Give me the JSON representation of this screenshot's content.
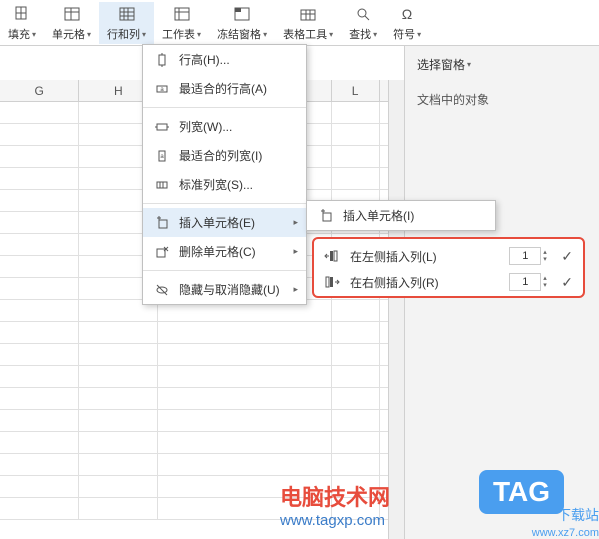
{
  "ribbon": {
    "items": [
      {
        "label": "填充",
        "icon": "fill"
      },
      {
        "label": "单元格",
        "icon": "cell"
      },
      {
        "label": "行和列",
        "icon": "rowcol",
        "active": true
      },
      {
        "label": "工作表",
        "icon": "sheet"
      },
      {
        "label": "冻结窗格",
        "icon": "freeze"
      },
      {
        "label": "表格工具",
        "icon": "tools"
      },
      {
        "label": "查找",
        "icon": "find"
      },
      {
        "label": "符号",
        "icon": "symbol"
      }
    ]
  },
  "cols": [
    "G",
    "H",
    "L"
  ],
  "menu": {
    "row_height": "行高(H)...",
    "best_row_height": "最适合的行高(A)",
    "col_width": "列宽(W)...",
    "best_col_width": "最适合的列宽(I)",
    "std_col_width": "标准列宽(S)...",
    "insert_cell": "插入单元格(E)",
    "delete_cell": "删除单元格(C)",
    "hide_unhide": "隐藏与取消隐藏(U)"
  },
  "submenu": {
    "insert_cell": "插入单元格(I)"
  },
  "highlight": {
    "insert_left": "在左侧插入列(L)",
    "insert_right": "在右侧插入列(R)",
    "value_left": "1",
    "value_right": "1"
  },
  "side": {
    "select_pane": "选择窗格",
    "objects_in_doc": "文档中的对象"
  },
  "watermark": {
    "line1": "电脑技术网",
    "line2": "www.tagxp.com"
  },
  "tag": "TAG",
  "dl": {
    "t1": "下载站",
    "t2": "www.xz7.com"
  }
}
